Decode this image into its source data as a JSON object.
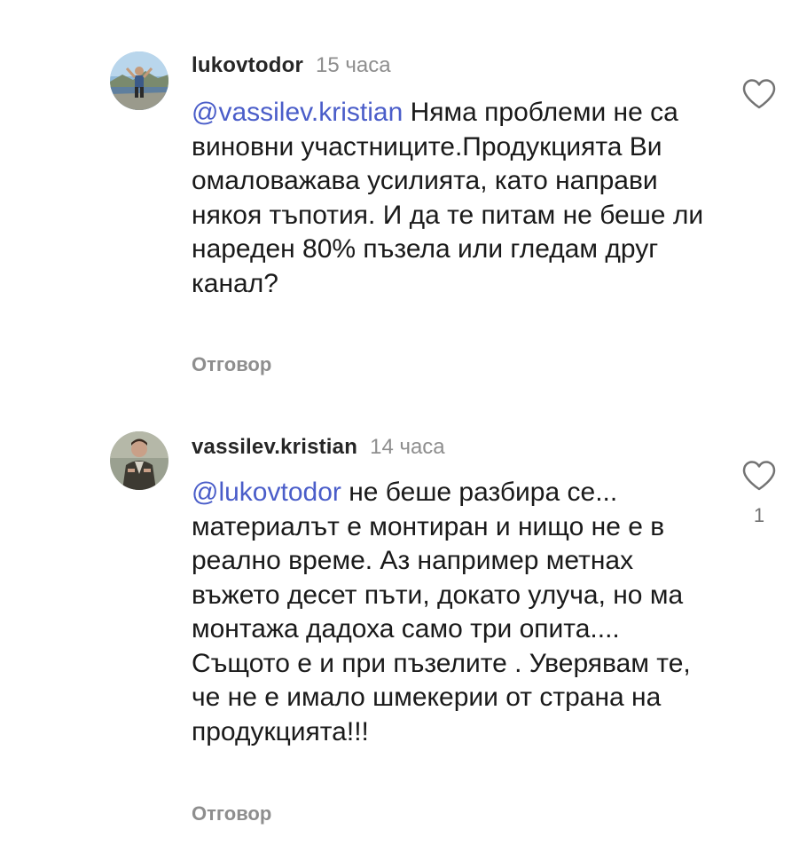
{
  "comments": [
    {
      "username": "lukovtodor",
      "time": "15 часа",
      "mention": "@vassilev.kristian",
      "text": " Няма проблеми не са виновни участниците.Продукцията Ви омаловажава усилията, като направи някоя тъпотия. И да те питам не беше ли нареден 80% пъзела или гледам друг канал?",
      "reply_label": "Отговор",
      "like_icon": "heart-outline-icon",
      "like_count": ""
    },
    {
      "username": "vassilev.kristian",
      "time": "14 часа",
      "mention": "@lukovtodor",
      "text": " не беше разбира се... материалът е монтиран и нищо не е в реално време. Аз например метнах въжето десет пъти, докато улуча, но ма монтажа дадоха само три опита.... Същото е и при пъзелите . Уверявам те, че не е имало шмекерии от страна на продукцията!!!",
      "reply_label": "Отговор",
      "like_icon": "heart-outline-icon",
      "like_count": "1"
    }
  ],
  "colors": {
    "mention": "#4a5dc9",
    "secondary_text": "#8e8e8e",
    "body_text": "#1a1a1a"
  }
}
